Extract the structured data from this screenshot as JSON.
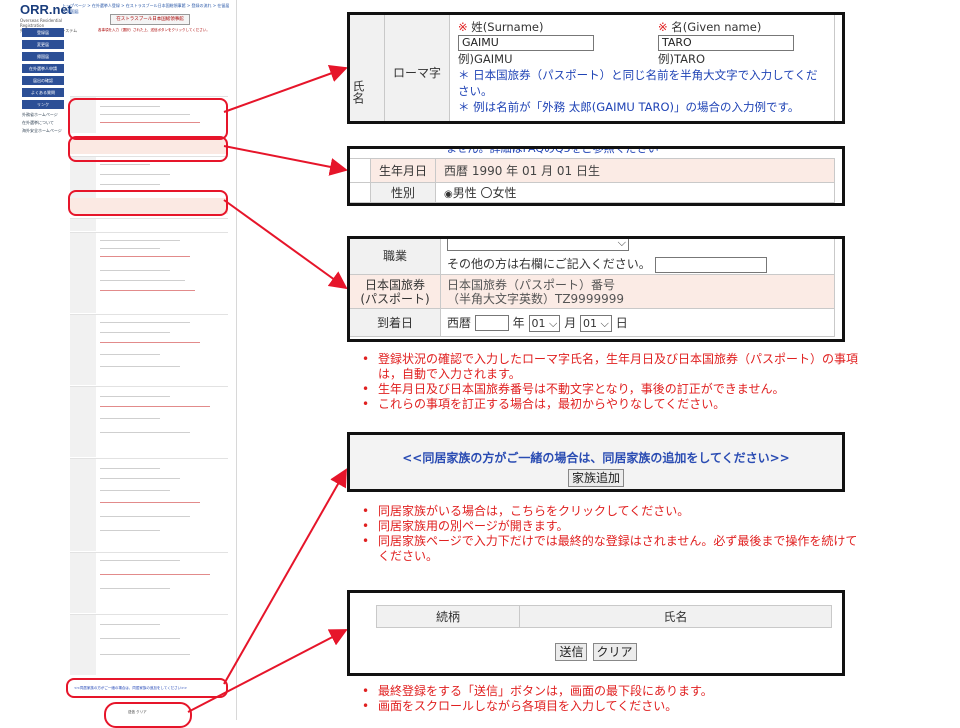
{
  "thumbnail": {
    "brand": "ORR.net",
    "brand_sub": "Overseas Residential Registration",
    "brand_sub_jp": "外務省 在外選挙人登録システム",
    "topnav": "トップページ > 在外選挙人登録 > 在ストラスブール日本国総領事館 > 登録の流れ > 在留届 > 帰国届",
    "side_buttons": [
      "登録届",
      "変更届",
      "帰国届",
      "在外選挙人申請",
      "届出の確認",
      "よくある質問",
      "リンク"
    ],
    "side_links": [
      "外務省ホームページ",
      "在外選挙について",
      "海外安全ホームページ"
    ],
    "form_title": "在ストラスブール日本国総領事館",
    "form_subtitle": "各事項を入力（選択）された上、送信ボタンをクリックしてください。",
    "family_link": "<<同居家族の方がご一緒の場合は、同居家族の追加をしてください>>",
    "bottom_label": "送信 クリア"
  },
  "panel_name": {
    "section_label": "氏名",
    "row_label": "ローマ字",
    "surname_mark": "※",
    "surname_label": "姓(Surname)",
    "surname_value": "GAIMU",
    "surname_example": "例)GAIMU",
    "given_mark": "※",
    "given_label": "名(Given name)",
    "given_value": "TARO",
    "given_example": "例)TARO",
    "note1": "＊ 日本国旅券（パスポート）と同じ名前を半角大文字で入力してください。",
    "note2": "＊ 例は名前が「外務 太郎(GAIMU TARO)」の場合の入力例です。"
  },
  "panel_birth": {
    "top_partial": "ません。詳細はFAQのQ5をご参照ください",
    "row_label": "生年月日",
    "value": "西暦 1990 年 01 月 01 日生",
    "next_label": "性別",
    "next_value": "男性 〇女性"
  },
  "panel_job": {
    "job_label": "職業",
    "job_hint": "その他の方は右欄にご記入ください。",
    "passport_label": "日本国旅券",
    "passport_label2": "(パスポート)",
    "passport_line1": "日本国旅券（パスポート）番号",
    "passport_line2": "（半角大文字英数）TZ9999999",
    "arrival_label": "到着日",
    "arrival_era": "西暦",
    "arrival_year_unit": "年",
    "arrival_month": "01",
    "arrival_month_unit": "月",
    "arrival_day": "01",
    "arrival_day_unit": "日"
  },
  "notes_1": [
    "登録状況の確認で入力したローマ字氏名，生年月日及び日本国旅券（パスポート）の事項は，自動で入力されます。",
    "生年月日及び日本国旅券番号は不動文字となり，事後の訂正ができません。",
    "これらの事項を訂正する場合は，最初からやりなしてください。"
  ],
  "panel_family": {
    "heading": "<<同居家族の方がご一緒の場合は、同居家族の追加をしてください>>",
    "button": "家族追加"
  },
  "notes_2": [
    "同居家族がいる場合は，こちらをクリックしてください。",
    "同居家族用の別ページが開きます。",
    "同居家族ページで入力下だけでは最終的な登録はされません。必ず最後まで操作を続けてください。"
  ],
  "panel_submit": {
    "col_relation": "続柄",
    "col_name": "氏名",
    "submit": "送信",
    "clear": "クリア"
  },
  "notes_3": [
    "最終登録をする「送信」ボタンは，画面の最下段にあります。",
    "画面をスクロールしながら各項目を入力してください。"
  ],
  "colors": {
    "highlight": "#e6152a",
    "note_red": "#e02020",
    "note_blue": "#1f43b5",
    "pink_row": "#fbebe5"
  }
}
